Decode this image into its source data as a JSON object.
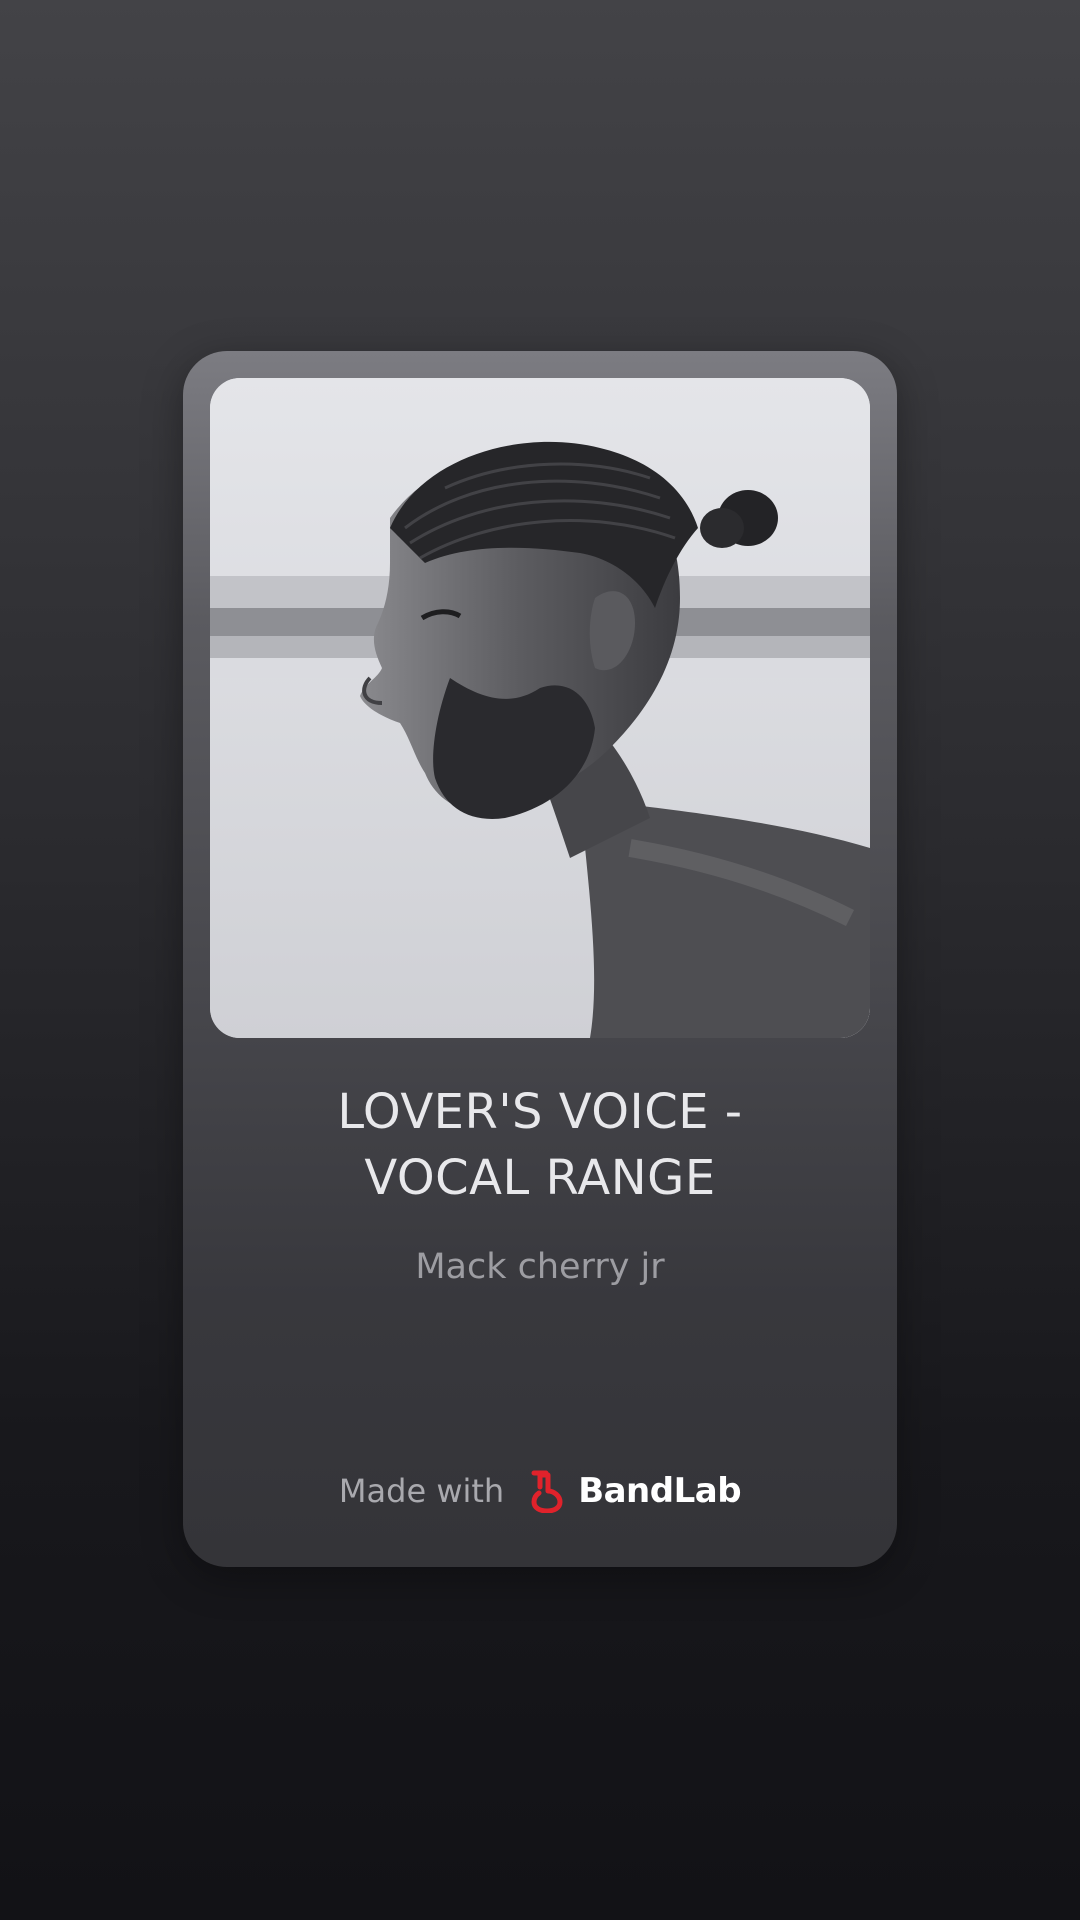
{
  "track": {
    "title_line1": "LOVER'S VOICE -",
    "title_line2": "VOCAL RANGE",
    "artist": "Mack cherry jr"
  },
  "footer": {
    "made_with": "Made with",
    "brand": "BandLab"
  },
  "colors": {
    "brand_red": "#e0222b"
  },
  "icons": {
    "logo": "bandlab-logo-icon"
  }
}
